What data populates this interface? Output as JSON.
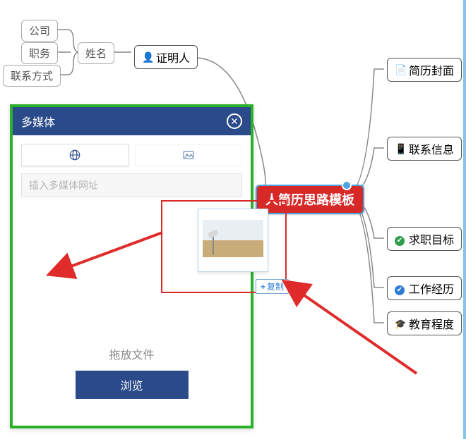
{
  "mindmap": {
    "top_left": {
      "company": "公司",
      "position": "职务",
      "name": "姓名",
      "contact": "联系方式"
    },
    "witness": "证明人",
    "central": "人简历思路模板",
    "right_nodes": [
      {
        "icon": "doc",
        "label": "简历封面"
      },
      {
        "icon": "phone",
        "label": "联系信息"
      },
      {
        "icon": "check",
        "label": "求职目标"
      },
      {
        "icon": "blue",
        "label": "工作经历"
      },
      {
        "icon": "edu",
        "label": "教育程度"
      }
    ]
  },
  "dialog": {
    "title": "多媒体",
    "tab_url": "网址",
    "tab_image": "图片",
    "placeholder": "插入多媒体网址",
    "drop_label": "拖放文件",
    "browse": "浏览"
  },
  "drag": {
    "copy_label": "复制"
  }
}
